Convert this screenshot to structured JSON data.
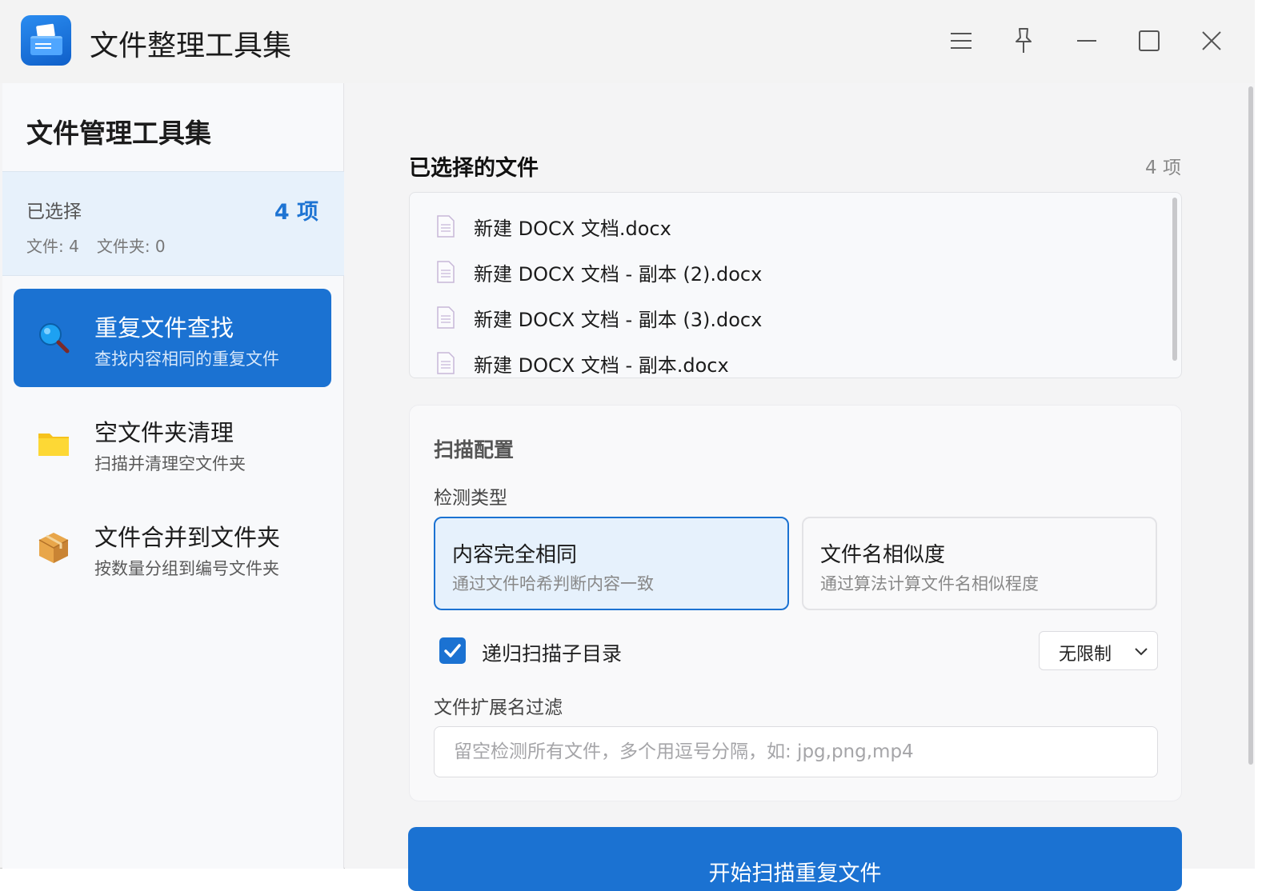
{
  "window": {
    "title": "文件整理工具集",
    "controls": {
      "menu_icon": "hamburger-icon",
      "pin_icon": "pin-icon",
      "minimize_icon": "minimize-icon",
      "maximize_icon": "maximize-icon",
      "close_icon": "close-icon"
    }
  },
  "sidebar": {
    "title": "文件管理工具集",
    "selected": {
      "label": "已选择",
      "count": "4 项",
      "files": "文件: 4",
      "folders": "文件夹: 0"
    },
    "items": [
      {
        "title": "重复文件查找",
        "subtitle": "查找内容相同的重复文件",
        "icon": "magnifier-icon",
        "active": true
      },
      {
        "title": "空文件夹清理",
        "subtitle": "扫描并清理空文件夹",
        "icon": "folder-icon",
        "active": false
      },
      {
        "title": "文件合并到文件夹",
        "subtitle": "按数量分组到编号文件夹",
        "icon": "package-icon",
        "active": false
      }
    ]
  },
  "main": {
    "files_heading": "已选择的文件",
    "files_count": "4 项",
    "files": [
      "新建 DOCX 文档.docx",
      "新建 DOCX 文档 - 副本 (2).docx",
      "新建 DOCX 文档 - 副本 (3).docx",
      "新建 DOCX 文档 - 副本.docx"
    ],
    "config": {
      "title": "扫描配置",
      "detect_label": "检测类型",
      "options": [
        {
          "title": "内容完全相同",
          "subtitle": "通过文件哈希判断内容一致",
          "selected": true
        },
        {
          "title": "文件名相似度",
          "subtitle": "通过算法计算文件名相似程度",
          "selected": false
        }
      ],
      "recursive_label": "递归扫描子目录",
      "recursive_checked": true,
      "depth_value": "无限制",
      "ext_label": "文件扩展名过滤",
      "ext_value": "",
      "ext_placeholder": "留空检测所有文件，多个用逗号分隔，如: jpg,png,mp4"
    },
    "scan_button": "开始扫描重复文件"
  },
  "colors": {
    "accent": "#1b72d2",
    "selected_bg": "#e6f1fc",
    "sidebar_bg": "#f8f9fb"
  }
}
